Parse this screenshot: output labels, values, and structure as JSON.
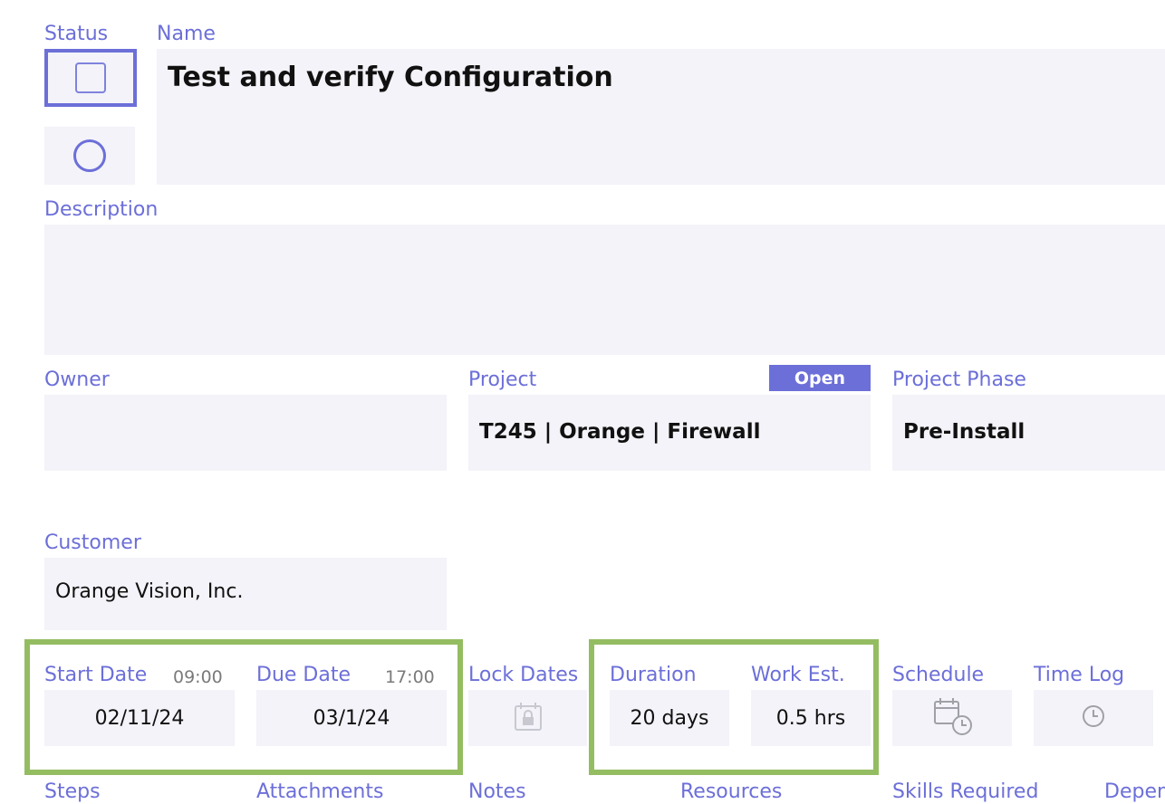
{
  "labels": {
    "status": "Status",
    "name": "Name",
    "description": "Description",
    "owner": "Owner",
    "project": "Project",
    "project_phase": "Project Phase",
    "customer": "Customer",
    "start_date": "Start Date",
    "due_date": "Due Date",
    "lock_dates": "Lock Dates",
    "duration": "Duration",
    "work_est": "Work Est.",
    "schedule": "Schedule",
    "time_log": "Time Log",
    "steps": "Steps",
    "attachments": "Attachments",
    "notes": "Notes",
    "resources": "Resources",
    "skills_required": "Skills Required",
    "dependencies": "Depen"
  },
  "task": {
    "name": "Test and verify Configuration",
    "description": "",
    "owner": "",
    "project": "T245 | Orange | Firewall",
    "project_open_button": "Open",
    "project_phase": "Pre-Install",
    "customer": "Orange Vision, Inc.",
    "start_time": "09:00",
    "start_date": "02/11/24",
    "due_time": "17:00",
    "due_date": "03/1/24",
    "duration": "20 days",
    "work_est": "0.5 hrs"
  },
  "icons": {
    "status_checkbox": "checkbox-icon",
    "status_circle": "circle-icon",
    "lock": "calendar-lock-icon",
    "schedule": "calendar-clock-icon",
    "time_log": "clock-icon"
  },
  "colors": {
    "label": "#6c6fd8",
    "accent_button": "#6c6fd8",
    "field_bg": "#f3f3f9",
    "highlight": "#94bd62"
  }
}
